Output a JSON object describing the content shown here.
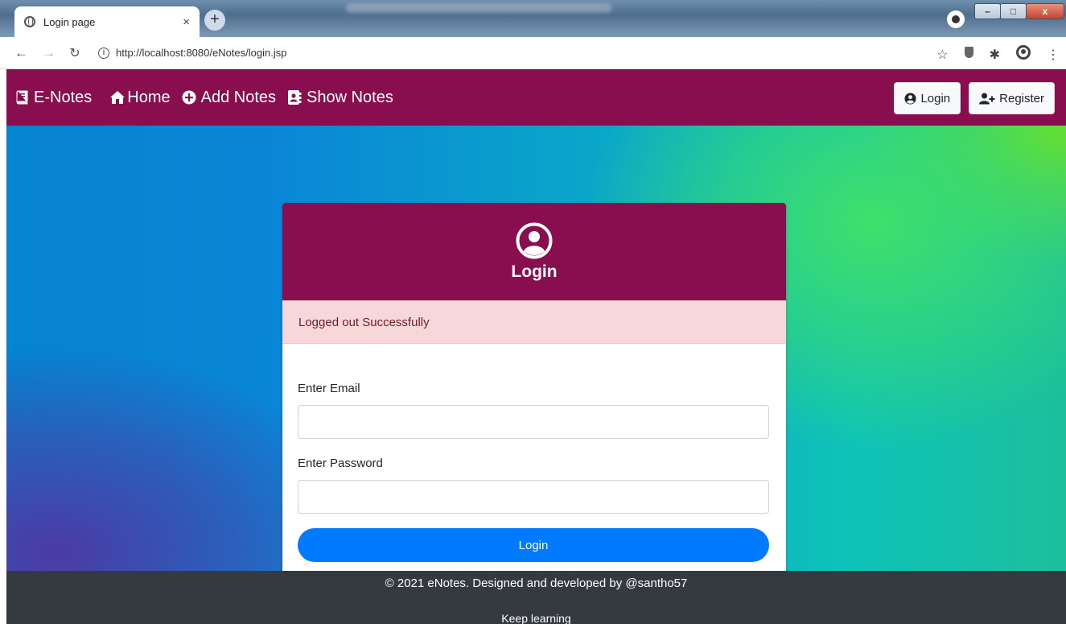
{
  "browser": {
    "tab_title": "Login page",
    "tab_close": "×",
    "new_tab": "+",
    "url": "http://localhost:8080/eNotes/login.jsp",
    "window_controls": {
      "minimize": "–",
      "maximize": "□",
      "close": "x"
    }
  },
  "navbar": {
    "brand": "E-Notes",
    "links": [
      {
        "label": "Home",
        "icon": "home-icon"
      },
      {
        "label": "Add Notes",
        "icon": "plus-circle-icon"
      },
      {
        "label": "Show Notes",
        "icon": "address-book-icon"
      }
    ],
    "login_label": "Login",
    "register_label": "Register"
  },
  "card": {
    "title": "Login",
    "alert": "Logged out Successfully",
    "email_label": "Enter Email",
    "email_value": "",
    "password_label": "Enter Password",
    "password_value": "",
    "submit_label": "Login"
  },
  "footer": {
    "line1": "© 2021 eNotes. Designed and developed by @santho57",
    "line2": "Keep learning"
  },
  "colors": {
    "navbar": "#880e4f",
    "alert_bg": "#f8d7da",
    "primary": "#007bff",
    "footer": "#343a40"
  }
}
